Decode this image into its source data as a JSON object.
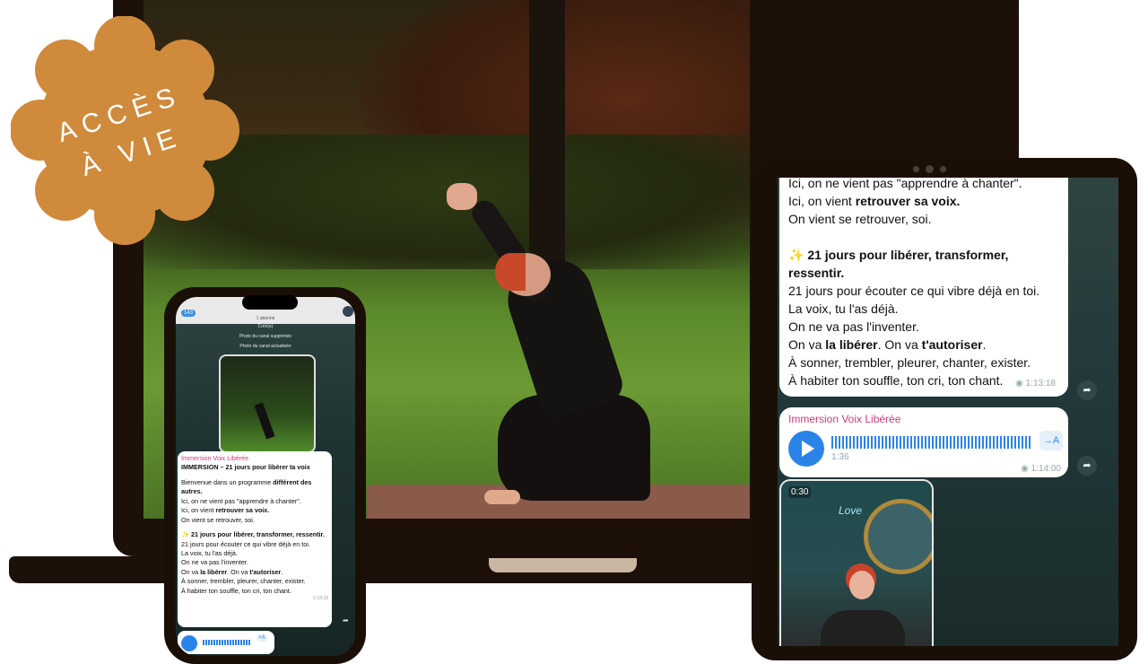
{
  "badge": {
    "line1": "ACCÈS",
    "line2": "À VIE",
    "color": "#d08a3c"
  },
  "phone": {
    "status_badge": "143",
    "header_lines": [
      "1 abonné",
      "Créé(e)",
      "Photo du canal supprimée",
      "Photo du canal actualisée"
    ],
    "channel_name": "Immersion Voix Libérée",
    "title": "IMMERSION – 21 jours pour libérer ta voix",
    "p1": "Bienvenue dans un programme ",
    "p1_bold": "différent des autres.",
    "p2": "Ici, on ne vient pas \"apprendre à chanter\".",
    "p3a": "Ici, on vient ",
    "p3b": "retrouver sa voix.",
    "p4": "On vient se retrouver, soi.",
    "heading": "✨ 21 jours pour libérer, transformer, ressentir.",
    "l1": "21 jours pour écouter ce qui vibre déjà en toi.",
    "l2": "La voix, tu l'as déjà.",
    "l3": "On ne va pas l'inventer.",
    "l4a": "On va ",
    "l4b": "la libérer",
    "l4c": ". On va ",
    "l4d": "t'autoriser",
    "l4e": ".",
    "l5": "À sonner, trembler, pleurer, chanter, exister.",
    "l6": "À habiter ton souffle, ton cri, ton chant.",
    "time": "1:13:18",
    "audio_label": "+A"
  },
  "tablet": {
    "line0": "Ici, on ne vient pas \"apprendre à chanter\".",
    "line1a": "Ici, on vient ",
    "line1b": "retrouver sa voix.",
    "line2": "On vient se retrouver, soi.",
    "heading_icon": "✨",
    "heading": "21 jours pour libérer, transformer, ressentir.",
    "l1": "21 jours pour écouter ce qui vibre déjà en toi.",
    "l2": "La voix, tu l'as déjà.",
    "l3": "On ne va pas l'inventer.",
    "l4a": "On va ",
    "l4b": "la libérer",
    "l4c": ". On va ",
    "l4d": "t'autoriser",
    "l4e": ".",
    "l5": "À sonner, trembler, pleurer, chanter, exister.",
    "l6": "À habiter ton souffle, ton cri, ton chant.",
    "time1": "1:13:18",
    "audio_sender": "Immersion Voix Libérée",
    "audio_duration": "1:36",
    "audio_transcribe": "→A",
    "time2": "1:14:00",
    "video_duration": "0:30",
    "video_sign": "Love"
  }
}
